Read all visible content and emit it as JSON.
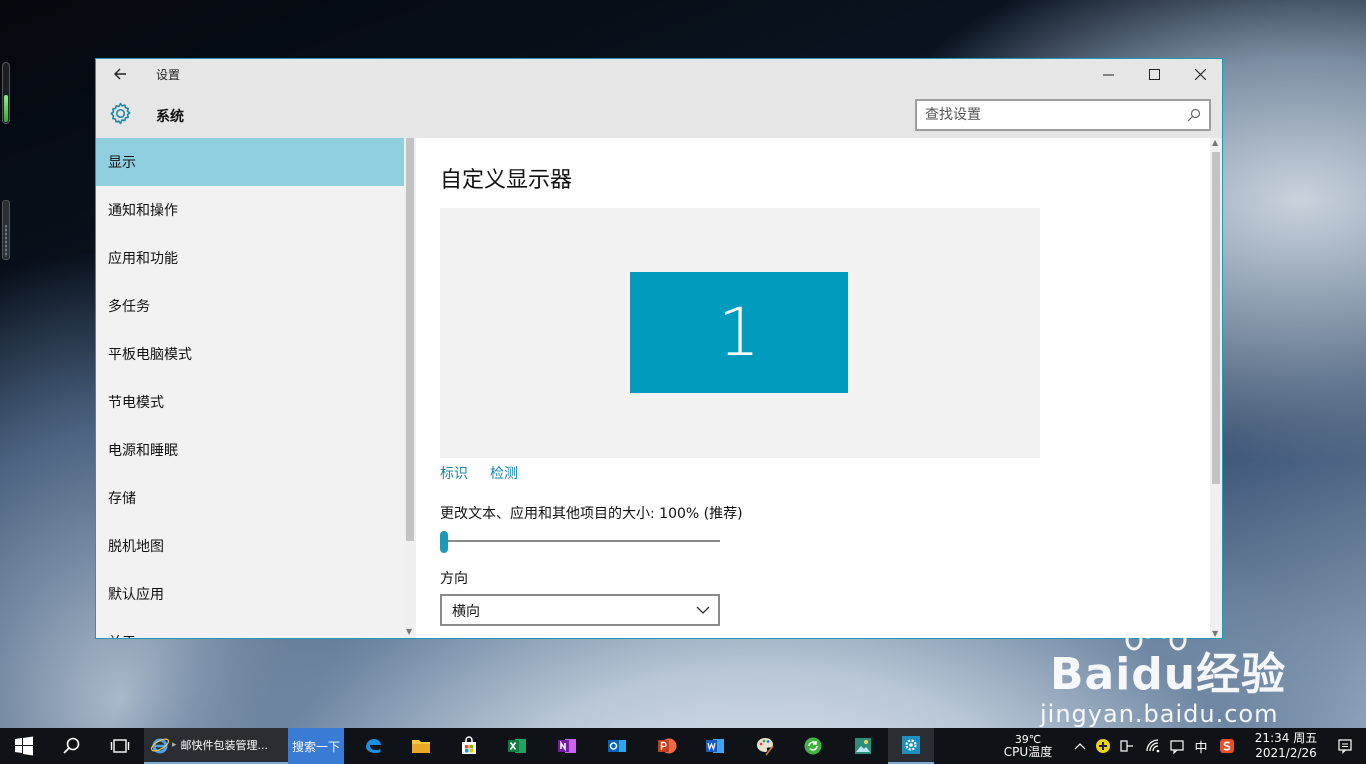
{
  "window": {
    "title": "设置",
    "section": "系统",
    "search_placeholder": "查找设置"
  },
  "sidebar": {
    "items": [
      {
        "label": "显示",
        "active": true
      },
      {
        "label": "通知和操作"
      },
      {
        "label": "应用和功能"
      },
      {
        "label": "多任务"
      },
      {
        "label": "平板电脑模式"
      },
      {
        "label": "节电模式"
      },
      {
        "label": "电源和睡眠"
      },
      {
        "label": "存储"
      },
      {
        "label": "脱机地图"
      },
      {
        "label": "默认应用"
      },
      {
        "label": "关于"
      }
    ]
  },
  "main": {
    "title": "自定义显示器",
    "monitor_number": "1",
    "identify_link": "标识",
    "detect_link": "检测",
    "scale_label": "更改文本、应用和其他项目的大小: 100% (推荐)",
    "scale_slider_fraction": 0,
    "orientation_label": "方向",
    "orientation_value": "横向"
  },
  "watermark": {
    "brand": "Baidu经验",
    "url": "jingyan.baidu.com"
  },
  "taskbar": {
    "ie_task_label": "邮快件包装管理...",
    "search_button": "搜索一下",
    "temperature": "39℃",
    "temperature_label": "CPU温度",
    "ime": "中",
    "time": "21:34 周五",
    "date": "2021/2/26"
  },
  "colors": {
    "accent": "#009bbd",
    "active_nav": "#8fcfdf",
    "link": "#1a86a8",
    "taskbar": "#0f1216"
  }
}
